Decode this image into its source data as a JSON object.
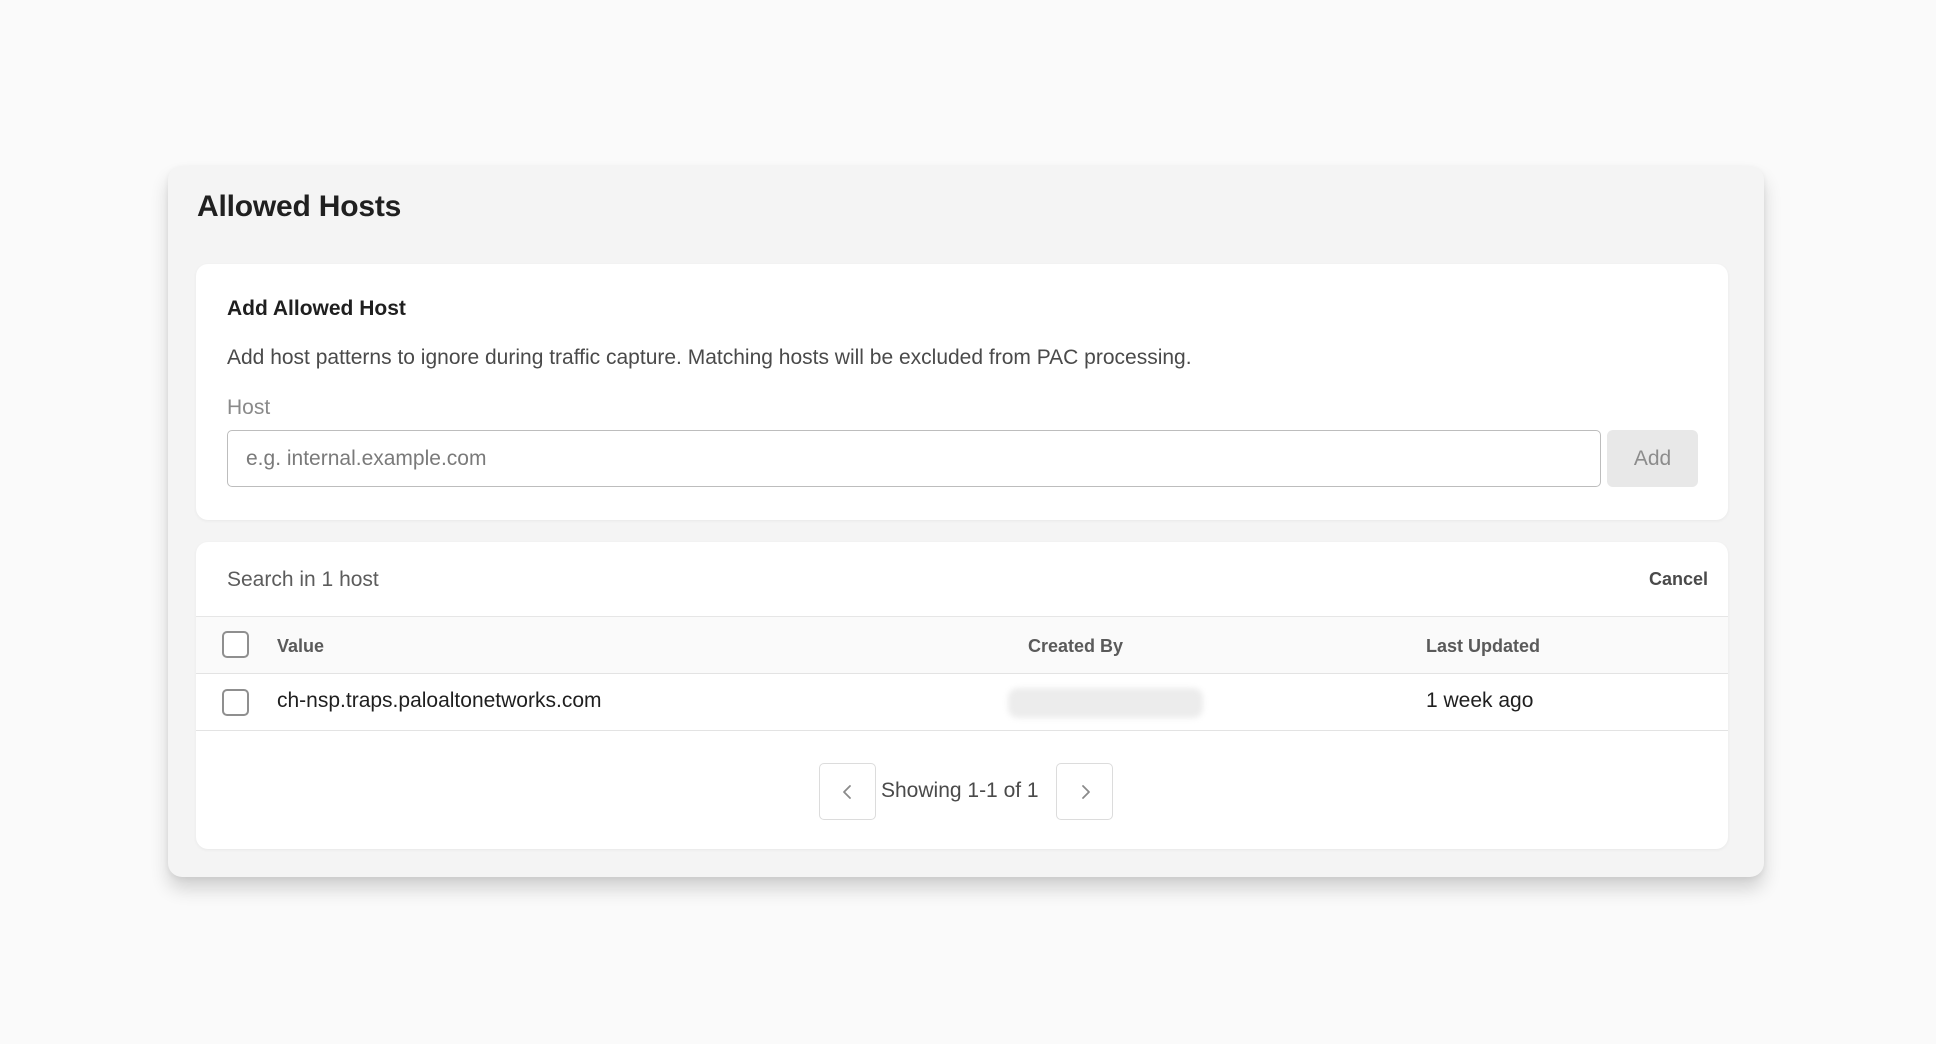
{
  "panel": {
    "title": "Allowed Hosts"
  },
  "add_host": {
    "title": "Add Allowed Host",
    "description": "Add host patterns to ignore during traffic capture. Matching hosts will be excluded from PAC processing.",
    "field_label": "Host",
    "input_value": "",
    "input_placeholder": "e.g. internal.example.com",
    "add_button_label": "Add"
  },
  "host_list": {
    "search_text": "Search in 1 host",
    "cancel_label": "Cancel",
    "columns": {
      "value": "Value",
      "created_by": "Created By",
      "last_updated": "Last Updated"
    },
    "rows": [
      {
        "value": "ch-nsp.traps.paloaltonetworks.com",
        "created_by": "",
        "last_updated": "1 week ago"
      }
    ],
    "pagination_text": "Showing 1-1 of 1"
  },
  "icons": {
    "prev": "chevron-left-icon",
    "next": "chevron-right-icon"
  },
  "colors": {
    "page_background": "#fafafa",
    "panel_background": "#f4f4f4",
    "card_background": "#ffffff",
    "add_button_background": "#e8e8e8"
  }
}
